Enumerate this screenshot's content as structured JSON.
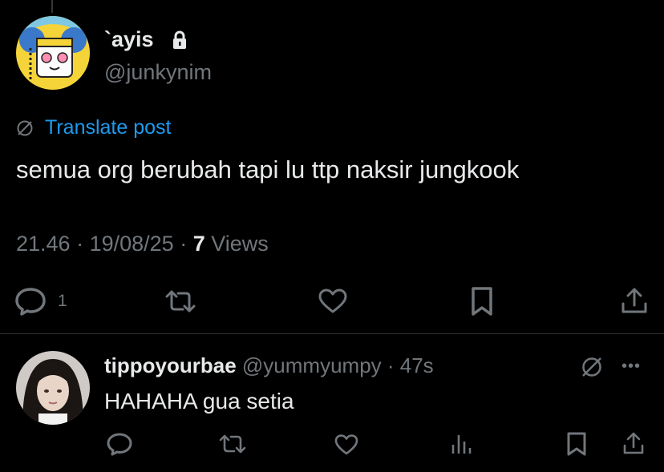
{
  "post": {
    "display_name": "`ayis",
    "handle": "@junkynim",
    "translate_label": "Translate post",
    "text": "semua org berubah tapi lu ttp naksir jungkook",
    "time": "21.46",
    "date": "19/08/25",
    "views_count": "7",
    "views_label": "Views",
    "reply_count": "1"
  },
  "reply": {
    "display_name": "tippoyourbae",
    "handle": "@yummyumpy",
    "age": "47s",
    "text": "HAHAHA gua setia"
  },
  "icons": {
    "lock": "lock-icon",
    "translate": "translate-icon",
    "reply": "reply-icon",
    "repost": "repost-icon",
    "like": "heart-icon",
    "bookmark": "bookmark-icon",
    "share": "share-icon",
    "analytics": "analytics-icon",
    "more": "more-icon"
  },
  "colors": {
    "background": "#000000",
    "text": "#e7e9ea",
    "muted": "#71767b",
    "link": "#1d9bf0",
    "divider": "#2f3336"
  }
}
